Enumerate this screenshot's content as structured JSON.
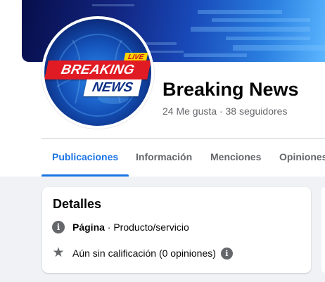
{
  "page": {
    "name": "Breaking News",
    "stats": "24 Me gusta · 38 seguidores"
  },
  "avatar_logo": {
    "live": "LIVE",
    "breaking": "BREAKING",
    "news": "NEWS"
  },
  "tabs": [
    {
      "label": "Publicaciones",
      "active": true
    },
    {
      "label": "Información",
      "active": false
    },
    {
      "label": "Menciones",
      "active": false
    },
    {
      "label": "Opiniones",
      "active": false
    }
  ],
  "details": {
    "title": "Detalles",
    "category_label": "Página",
    "category_value": " · Producto/servicio",
    "rating_text": "Aún sin calificación (0 opiniones)"
  },
  "colors": {
    "accent": "#1b74e4",
    "secondary_text": "#65676b",
    "background": "#f0f2f5",
    "logo_red": "#e01b24",
    "logo_yellow": "#ffd400"
  },
  "icons": {
    "category": "info-icon",
    "rating": "star-icon",
    "rating_info": "info-icon"
  }
}
